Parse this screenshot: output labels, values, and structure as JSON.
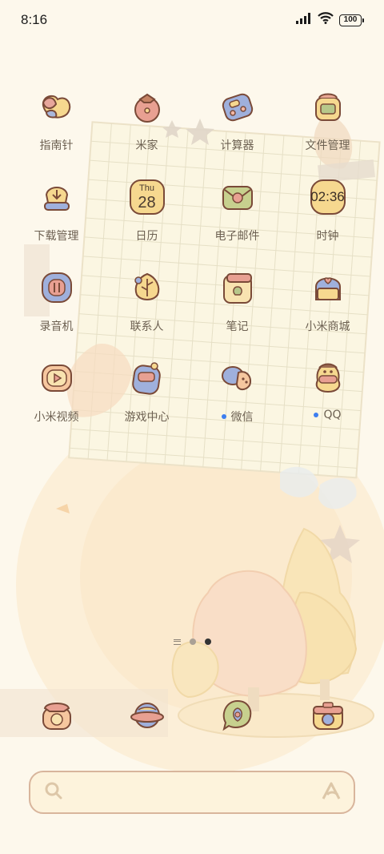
{
  "status_bar": {
    "time": "8:16",
    "battery": "100"
  },
  "apps": [
    {
      "label": "指南针",
      "icon": "compass-icon",
      "badge": false
    },
    {
      "label": "米家",
      "icon": "persimmon-icon",
      "badge": false
    },
    {
      "label": "计算器",
      "icon": "calculator-icon",
      "badge": false
    },
    {
      "label": "文件管理",
      "icon": "folder-icon",
      "badge": false
    },
    {
      "label": "下载管理",
      "icon": "download-icon",
      "badge": false
    },
    {
      "label": "日历",
      "icon": "calendar-icon",
      "badge": false,
      "day": "Thu",
      "date": "28"
    },
    {
      "label": "电子邮件",
      "icon": "email-icon",
      "badge": false
    },
    {
      "label": "时钟",
      "icon": "clock-icon",
      "badge": false,
      "time": "02:36"
    },
    {
      "label": "录音机",
      "icon": "recorder-icon",
      "badge": false
    },
    {
      "label": "联系人",
      "icon": "contacts-icon",
      "badge": false
    },
    {
      "label": "笔记",
      "icon": "notes-icon",
      "badge": false
    },
    {
      "label": "小米商城",
      "icon": "mi-store-icon",
      "badge": false
    },
    {
      "label": "小米视频",
      "icon": "video-icon",
      "badge": false
    },
    {
      "label": "游戏中心",
      "icon": "game-center-icon",
      "badge": false
    },
    {
      "label": "微信",
      "icon": "wechat-icon",
      "badge": true
    },
    {
      "label": "QQ",
      "icon": "qq-icon",
      "badge": true
    }
  ],
  "page_indicator": {
    "pages": 2,
    "active": 2
  },
  "dock": [
    {
      "icon": "phone-icon"
    },
    {
      "icon": "browser-icon"
    },
    {
      "icon": "messages-icon"
    },
    {
      "icon": "camera-icon"
    }
  ],
  "search": {
    "placeholder": ""
  },
  "colors": {
    "background": "#fdf8ec",
    "icon_outline": "#7a4a38",
    "badge_dot": "#3d7ef0",
    "search_border": "#d8b59c"
  }
}
